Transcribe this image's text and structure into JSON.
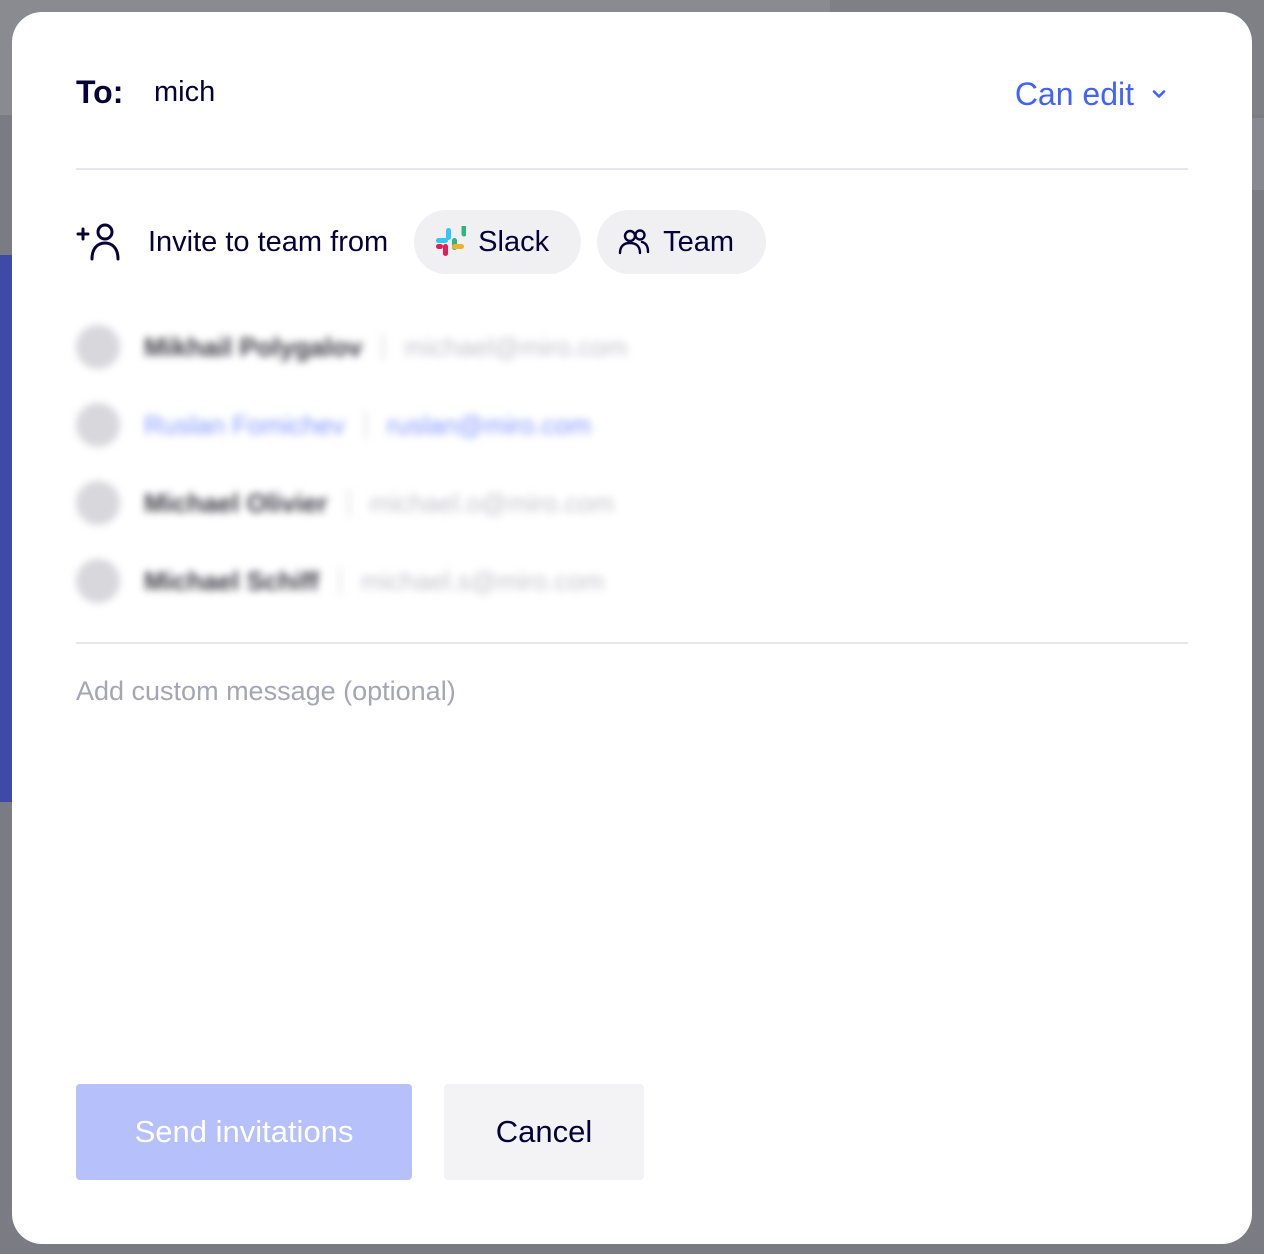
{
  "header": {
    "to_label": "To:",
    "to_value": "mich",
    "permission_label": "Can edit",
    "permission_icon": "chevron-down-icon"
  },
  "invite": {
    "label": "Invite to team from",
    "icon": "add-user-icon",
    "sources": [
      {
        "label": "Slack",
        "icon": "slack-logo-icon"
      },
      {
        "label": "Team",
        "icon": "team-icon"
      }
    ]
  },
  "suggestions": [
    {
      "name": "Mikhail Polygalov",
      "email": "michael@miro.com"
    },
    {
      "name": "Ruslan Fomichev",
      "email": "ruslan@miro.com"
    },
    {
      "name": "Michael Olivier",
      "email": "michael.o@miro.com"
    },
    {
      "name": "Michael Schiff",
      "email": "michael.s@miro.com"
    }
  ],
  "message": {
    "placeholder": "Add custom message (optional)",
    "value": ""
  },
  "actions": {
    "send_label": "Send invitations",
    "cancel_label": "Cancel"
  },
  "colors": {
    "accent": "#4262ff",
    "send_disabled": "#b6c0fb",
    "text_primary": "#050038",
    "placeholder": "#a5a5b3"
  }
}
